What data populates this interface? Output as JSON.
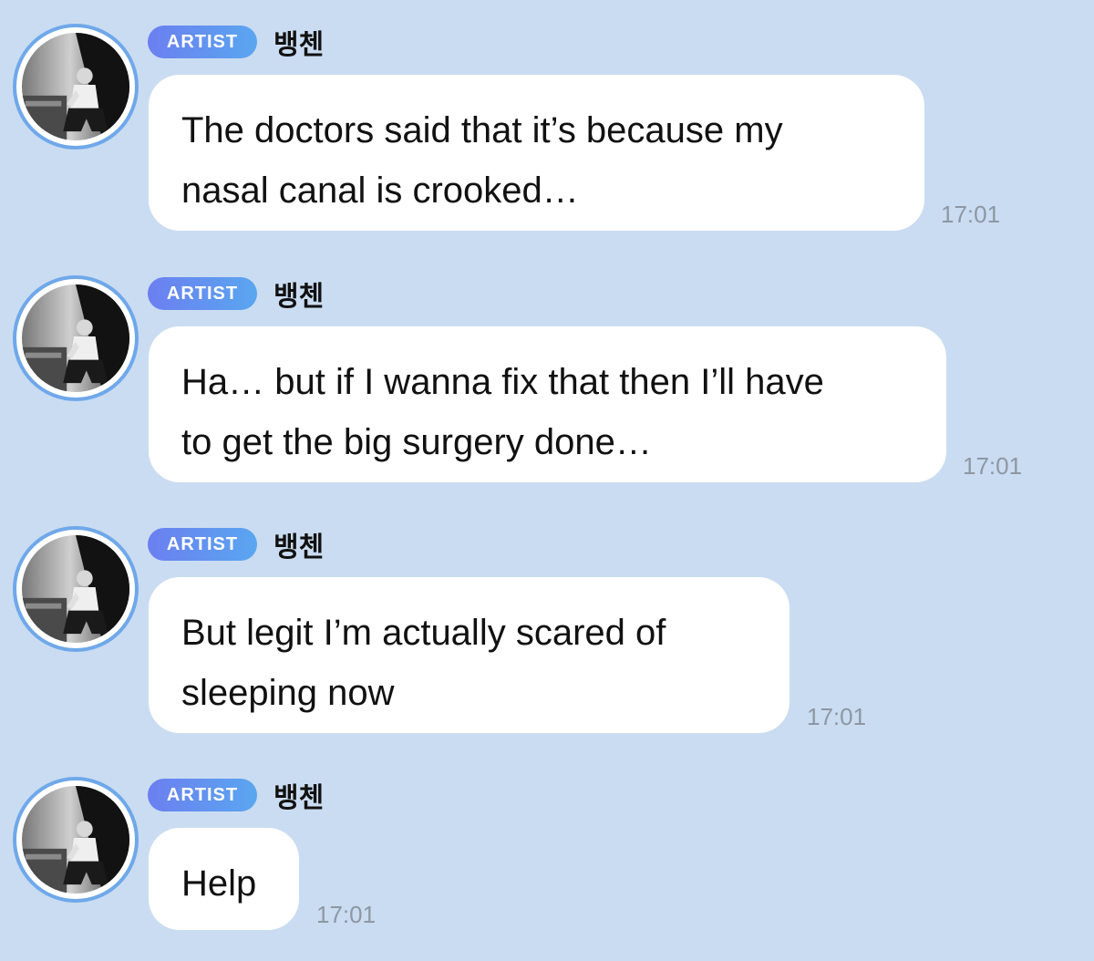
{
  "messages": [
    {
      "badge": "ARTIST",
      "sender": "뱅첸",
      "text": "The doctors said that it’s because my\nnasal canal is crooked…",
      "time": "17:01"
    },
    {
      "badge": "ARTIST",
      "sender": "뱅첸",
      "text": "Ha… but if I wanna fix that then I’ll have\nto get the big surgery done…",
      "time": "17:01"
    },
    {
      "badge": "ARTIST",
      "sender": "뱅첸",
      "text": "But legit I’m actually scared of\nsleeping now",
      "time": "17:01"
    },
    {
      "badge": "ARTIST",
      "sender": "뱅첸",
      "text": "Help",
      "time": "17:01"
    }
  ],
  "colors": {
    "background": "#cadcf1",
    "bubble": "#ffffff",
    "badge_start": "#6b7ff0",
    "badge_end": "#5aa6f0",
    "avatar_ring": "#6fa8ea",
    "timestamp": "#8e97a3"
  },
  "icons": {
    "avatar": "profile-photo"
  }
}
